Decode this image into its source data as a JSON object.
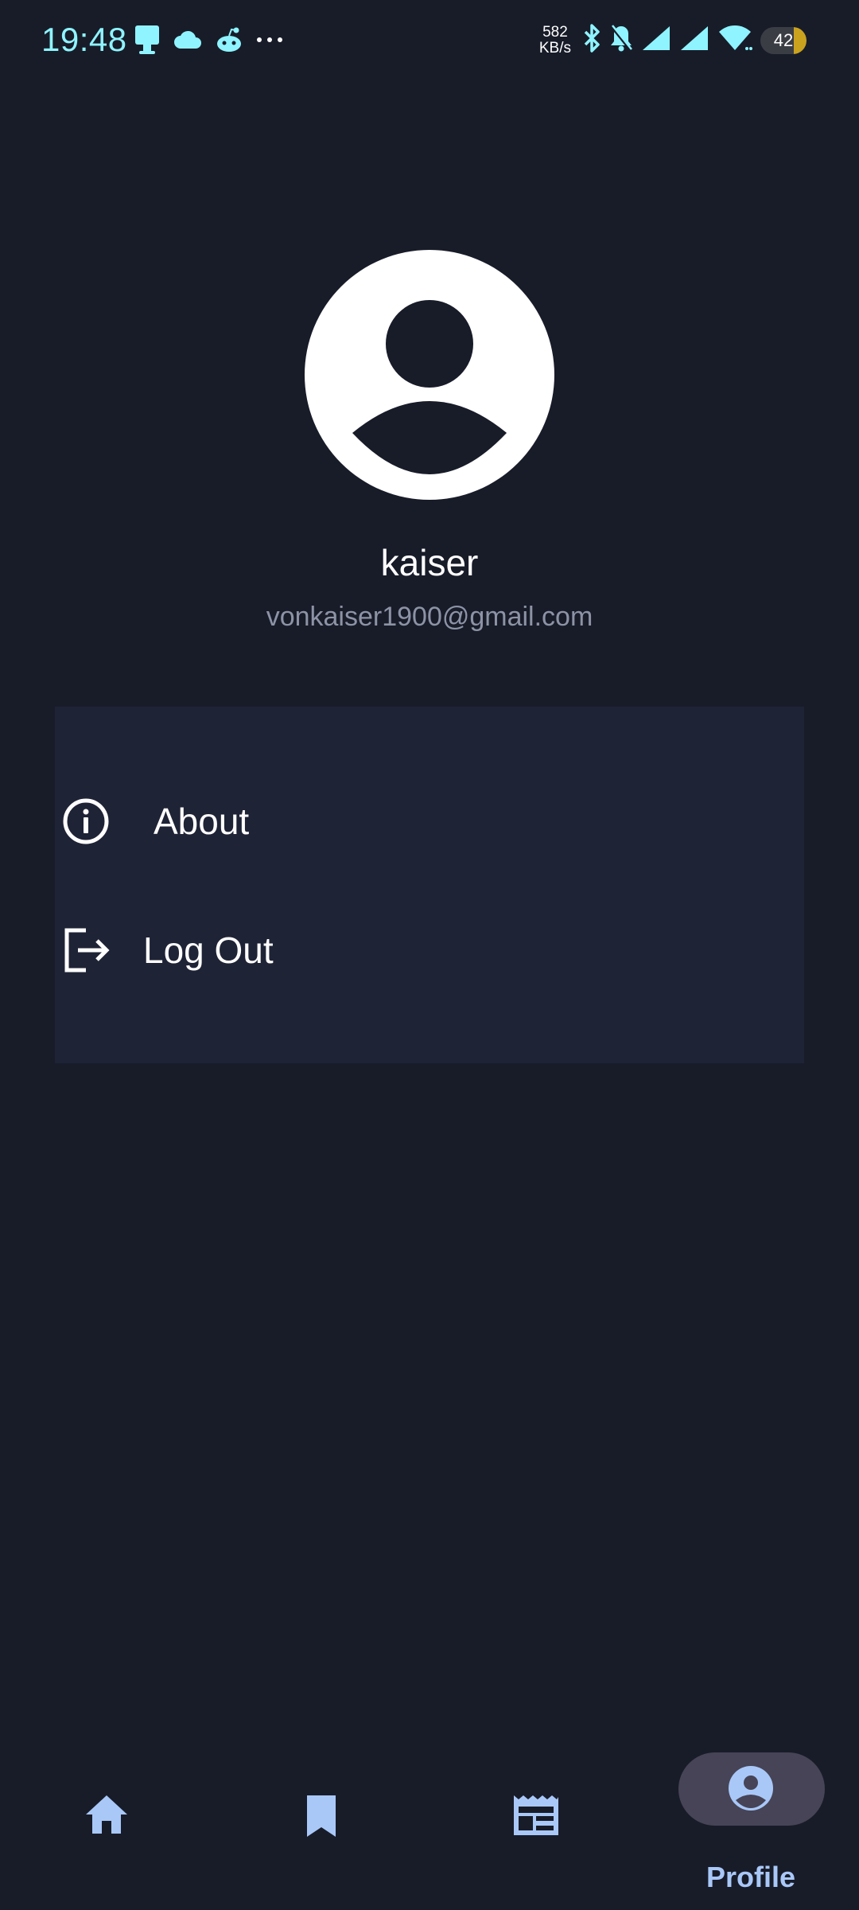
{
  "status_bar": {
    "time": "19:48",
    "net_speed_value": "582",
    "net_speed_unit": "KB/s",
    "battery_level": "42",
    "left_icons": [
      "usb-icon",
      "cloud-icon",
      "reddit-icon",
      "more-dots-icon"
    ],
    "right_icons": [
      "bluetooth-icon",
      "mute-bell-icon",
      "signal-icon",
      "signal-icon",
      "wifi-icon"
    ],
    "accent_color": "#8ff4ff"
  },
  "profile": {
    "name": "kaiser",
    "email": "vonkaiser1900@gmail.com",
    "avatar_icon": "account-circle-icon"
  },
  "menu": {
    "items": [
      {
        "label": "About",
        "icon": "info-icon"
      },
      {
        "label": "Log Out",
        "icon": "logout-icon"
      }
    ]
  },
  "bottom_nav": {
    "items": [
      {
        "icon": "home-icon",
        "label": "",
        "active": false
      },
      {
        "icon": "bookmark-icon",
        "label": "",
        "active": false
      },
      {
        "icon": "newspaper-icon",
        "label": "",
        "active": false
      },
      {
        "icon": "profile-icon",
        "label": "Profile",
        "active": true
      }
    ],
    "active_color": "#a9c8f8"
  },
  "colors": {
    "background": "#181c29",
    "card": "#1f2336",
    "muted_text": "#8d93a5",
    "active_pill": "#464456"
  }
}
